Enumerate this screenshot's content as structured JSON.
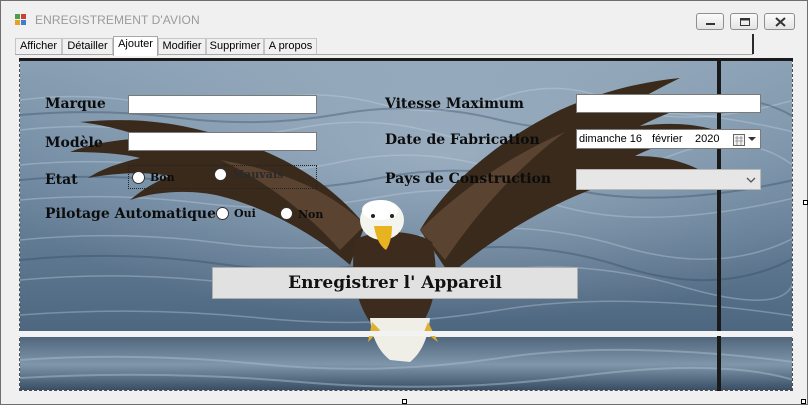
{
  "window": {
    "title": "ENREGISTREMENT D'AVION",
    "app_icon": "windows-forms-icon",
    "controls": [
      "minimize-icon",
      "maximize-icon",
      "close-icon"
    ]
  },
  "tabs": [
    {
      "label": "Afficher",
      "active": false
    },
    {
      "label": "Détailler",
      "active": false
    },
    {
      "label": "Ajouter",
      "active": true
    },
    {
      "label": "Modifier",
      "active": false
    },
    {
      "label": "Supprimer",
      "active": false
    },
    {
      "label": "A propos",
      "active": false
    }
  ],
  "form": {
    "marque_label": "Marque",
    "marque_value": "",
    "modele_label": "Modèle",
    "modele_value": "",
    "etat_label": "Etat",
    "etat_options": [
      "Bon",
      "Mauvais"
    ],
    "pilotage_label": "Pilotage Automatique",
    "pilotage_options": [
      "Oui",
      "Non"
    ],
    "vitesse_label": "Vitesse Maximum",
    "vitesse_value": "",
    "date_label": "Date de Fabrication",
    "date_day": "dimanche 16",
    "date_month": "février",
    "date_year": "2020",
    "pays_label": "Pays de Construction",
    "pays_value": "",
    "submit_label": "Enregistrer l' Appareil"
  },
  "colors": {
    "window_bg": "#f0f0f0",
    "water": "#6f8aa3",
    "eagle_body": "#3b2a1c",
    "beak": "#e8b320"
  }
}
